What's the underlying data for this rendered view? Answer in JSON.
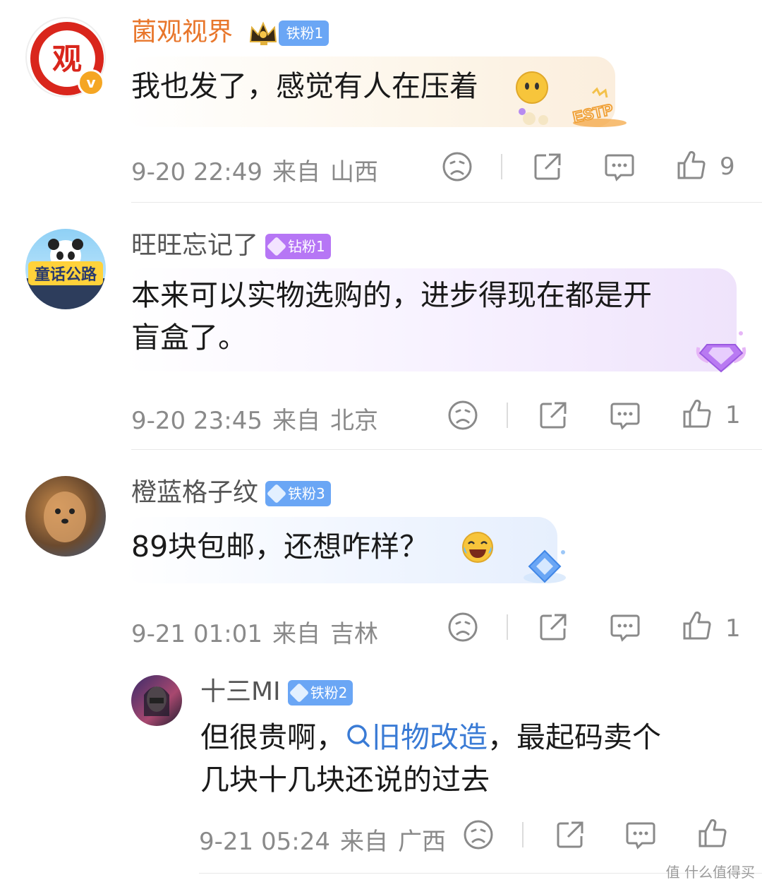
{
  "comments": [
    {
      "username": "菌观视界",
      "username_color": "#e8762b",
      "badge": "铁粉1",
      "badge_color": "#6aa6f5",
      "text": "我也发了，感觉有人在压着",
      "emoji": "neutral-face-emoji",
      "sticker": "ESTP",
      "time": "9-20 22:49",
      "from_label": "来自",
      "location": "山西",
      "likes": "9",
      "avatar_text": "观"
    },
    {
      "username": "旺旺忘记了",
      "username_color": "#555555",
      "badge": "钻粉1",
      "badge_color": "#b676f5",
      "text_line1": "本来可以实物选购的，进步得现在都是开",
      "text_line2": "盲盒了。",
      "time": "9-20 23:45",
      "from_label": "来自",
      "location": "北京",
      "likes": "1",
      "avatar_text": "童话公路"
    },
    {
      "username": "橙蓝格子纹",
      "username_color": "#555555",
      "badge": "铁粉3",
      "badge_color": "#6aa6f5",
      "text": "89块包邮，还想咋样？",
      "emoji": "tears-of-joy-emoji",
      "time": "9-21 01:01",
      "from_label": "来自",
      "location": "吉林",
      "likes": "1"
    }
  ],
  "reply": {
    "username": "十三MI",
    "badge": "铁粉2",
    "badge_color": "#6aa6f5",
    "text_before": "但很贵啊，",
    "topic": "旧物改造",
    "text_after": "，最起码卖个",
    "text_line2": "几块十几块还说的过去",
    "time": "9-21 05:24",
    "from_label": "来自",
    "location": "广西"
  },
  "watermark": "值 什么值得买",
  "colors": {
    "meta": "#8a8a8a",
    "topic": "#3a7bd5",
    "divider": "#e8e8e8"
  }
}
